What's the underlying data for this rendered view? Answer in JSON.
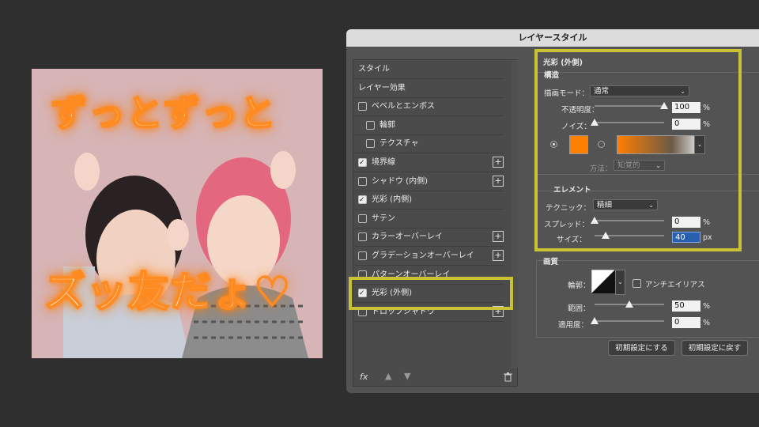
{
  "photo": {
    "top_text": "ずっとずっと",
    "bottom_text": "ズッ友だょ♡"
  },
  "dialog": {
    "title": "レイヤースタイル",
    "left_items": [
      {
        "label": "スタイル",
        "checkbox": false,
        "checked": false,
        "plus": false,
        "indent": false
      },
      {
        "label": "レイヤー効果",
        "checkbox": false,
        "checked": false,
        "plus": false,
        "indent": false
      },
      {
        "label": "ベベルとエンボス",
        "checkbox": true,
        "checked": false,
        "plus": false,
        "indent": false
      },
      {
        "label": "輪郭",
        "checkbox": true,
        "checked": false,
        "plus": false,
        "indent": true
      },
      {
        "label": "テクスチャ",
        "checkbox": true,
        "checked": false,
        "plus": false,
        "indent": true
      },
      {
        "label": "境界線",
        "checkbox": true,
        "checked": true,
        "plus": true,
        "indent": false
      },
      {
        "label": "シャドウ (内側)",
        "checkbox": true,
        "checked": false,
        "plus": true,
        "indent": false
      },
      {
        "label": "光彩 (内側)",
        "checkbox": true,
        "checked": true,
        "plus": false,
        "indent": false
      },
      {
        "label": "サテン",
        "checkbox": true,
        "checked": false,
        "plus": false,
        "indent": false
      },
      {
        "label": "カラーオーバーレイ",
        "checkbox": true,
        "checked": false,
        "plus": true,
        "indent": false
      },
      {
        "label": "グラデーションオーバーレイ",
        "checkbox": true,
        "checked": false,
        "plus": true,
        "indent": false
      },
      {
        "label": "パターンオーバーレイ",
        "checkbox": true,
        "checked": false,
        "plus": false,
        "indent": false
      },
      {
        "label": "光彩 (外側)",
        "checkbox": true,
        "checked": true,
        "plus": false,
        "indent": false
      },
      {
        "label": "ドロップシャドウ",
        "checkbox": true,
        "checked": false,
        "plus": true,
        "indent": false
      }
    ],
    "fx_label": "fx",
    "outer_glow": {
      "title": "光彩 (外側)",
      "structure": {
        "title": "構造",
        "blend_mode_label": "描画モード：",
        "blend_mode_value": "通常",
        "opacity_label": "不透明度：",
        "opacity_value": "100",
        "opacity_unit": "%",
        "opacity": 1.0,
        "noise_label": "ノイズ：",
        "noise_value": "0",
        "noise_unit": "%",
        "noise": 0.0,
        "glow_color": "#ff7f00",
        "method_label": "方法：",
        "method_value": "知覚的"
      },
      "elements": {
        "title": "エレメント",
        "technique_label": "テクニック：",
        "technique_value": "精細",
        "spread_label": "スプレッド：",
        "spread_value": "0",
        "spread_unit": "%",
        "spread": 0.0,
        "size_label": "サイズ：",
        "size_value": "40",
        "size_unit": "px",
        "size": 0.16
      },
      "quality": {
        "title": "画質",
        "contour_label": "輪郭：",
        "antialias_label": "アンチエイリアス",
        "range_label": "範囲：",
        "range_value": "50",
        "range_unit": "%",
        "range": 0.5,
        "jitter_label": "適用度：",
        "jitter_value": "0",
        "jitter_unit": "%",
        "jitter": 0.0
      },
      "make_default": "初期設定にする",
      "reset_default": "初期設定に戻す"
    }
  },
  "highlight_color": "#c8c234"
}
